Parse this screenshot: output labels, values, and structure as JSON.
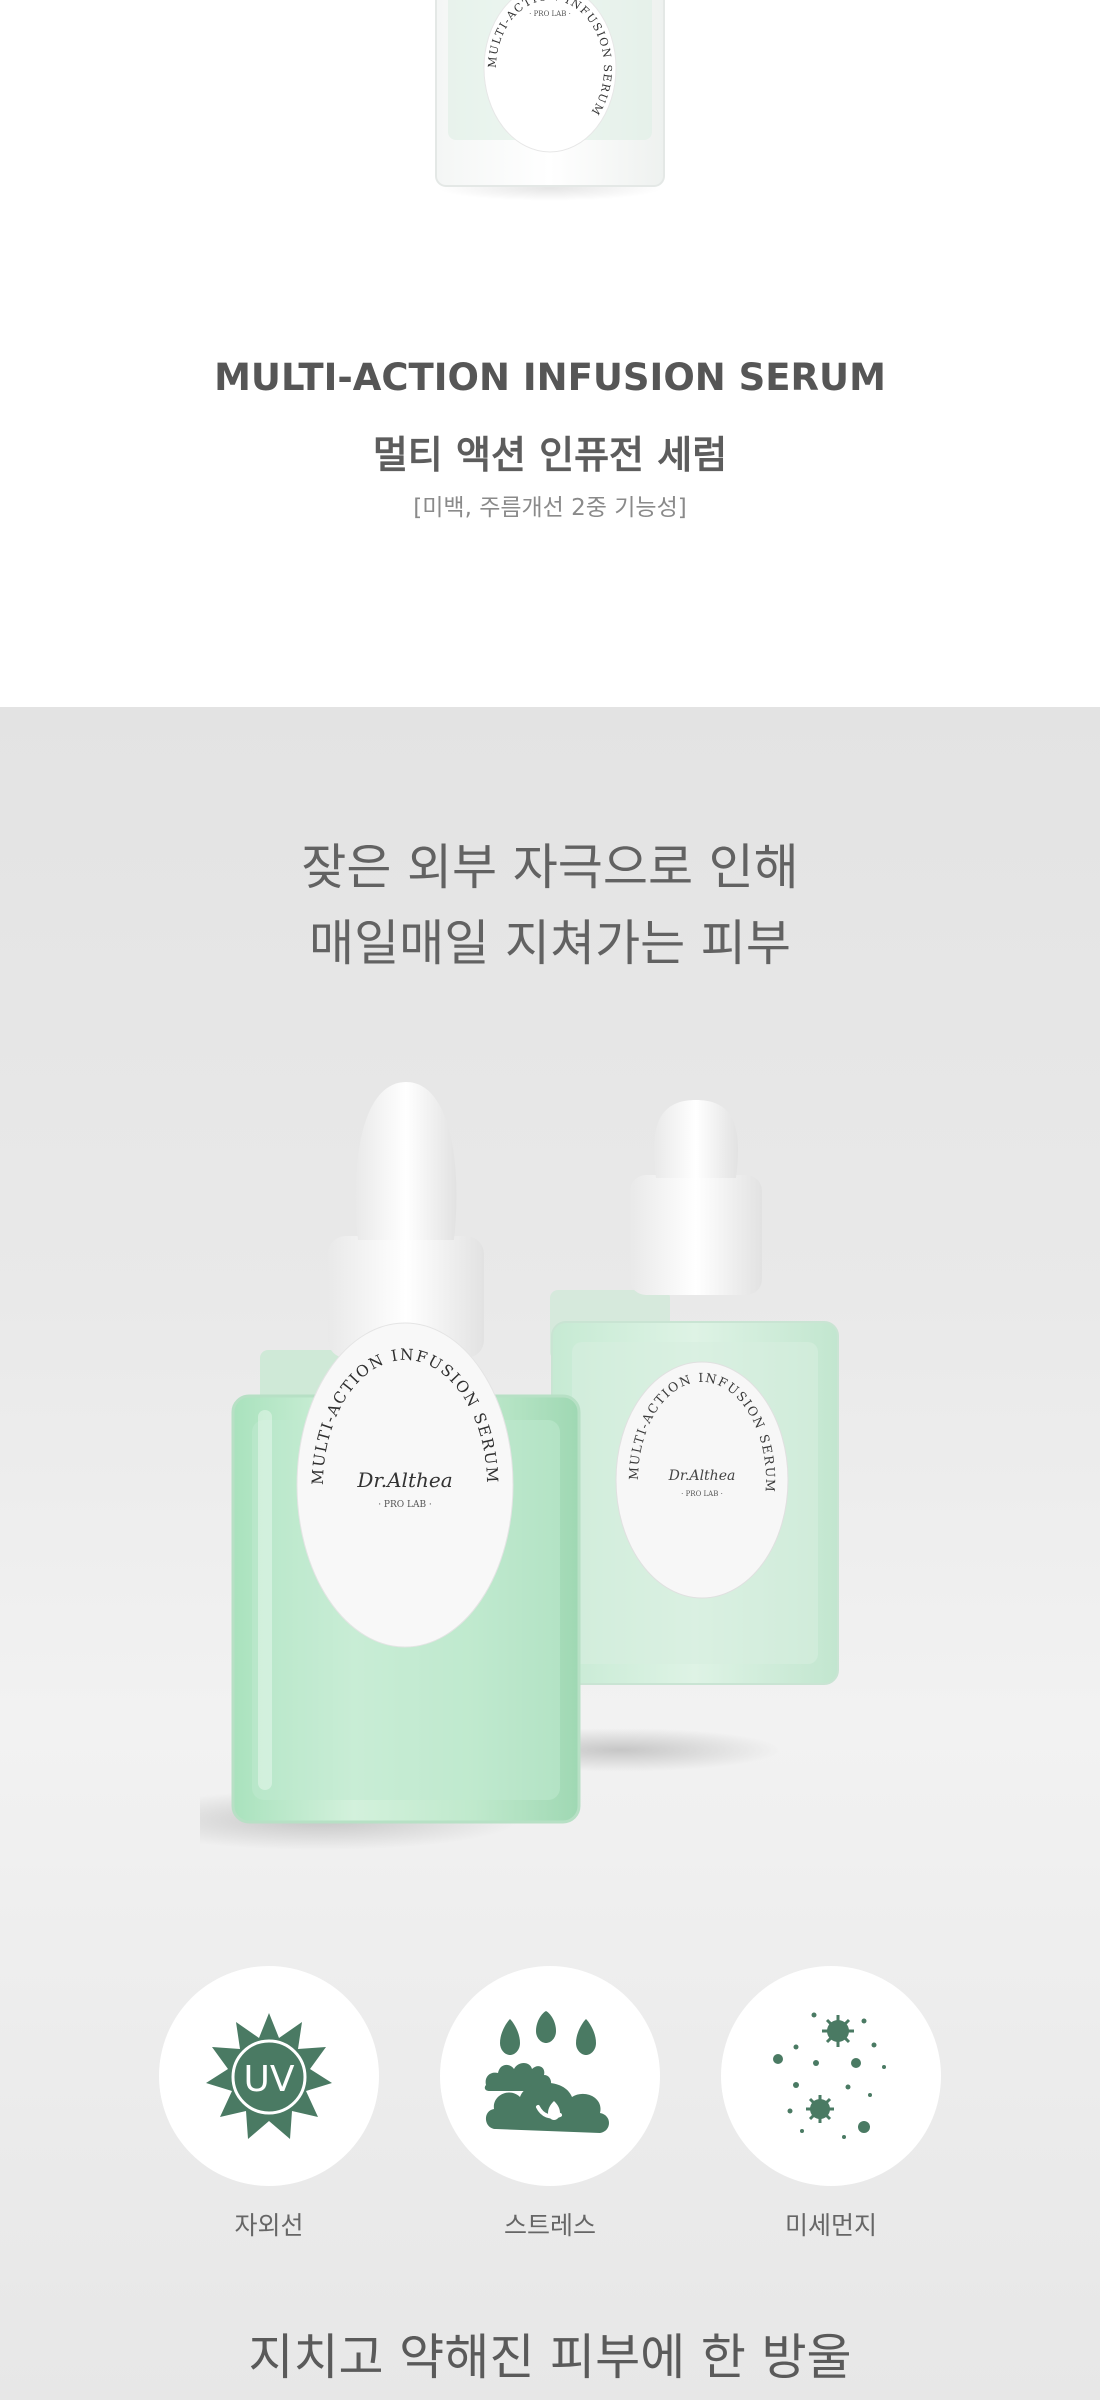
{
  "product": {
    "name_en": "MULTI-ACTION INFUSION SERUM",
    "name_ko": "멀티 액션 인퓨전 세럼",
    "functions": "[미백, 주름개선 2중 기능성]",
    "label_ring_text": "MULTI-ACTION INFUSION SERUM",
    "brand": "Dr.Althea",
    "brand_sub": "· PRO LAB ·"
  },
  "headline": {
    "line1": "잦은 외부 자극으로 인해",
    "line2": "매일매일 지쳐가는 피부"
  },
  "stressors": [
    {
      "label": "자외선",
      "icon": "uv-sun-icon",
      "icon_text": "UV"
    },
    {
      "label": "스트레스",
      "icon": "stress-cloud-icon"
    },
    {
      "label": "미세먼지",
      "icon": "fine-dust-icon"
    }
  ],
  "bottom_text": "지치고 약해진 피부에 한 방울",
  "colors": {
    "icon_green": "#4a7a63",
    "serum_green": "#bfe7cc",
    "text": "#555555"
  }
}
